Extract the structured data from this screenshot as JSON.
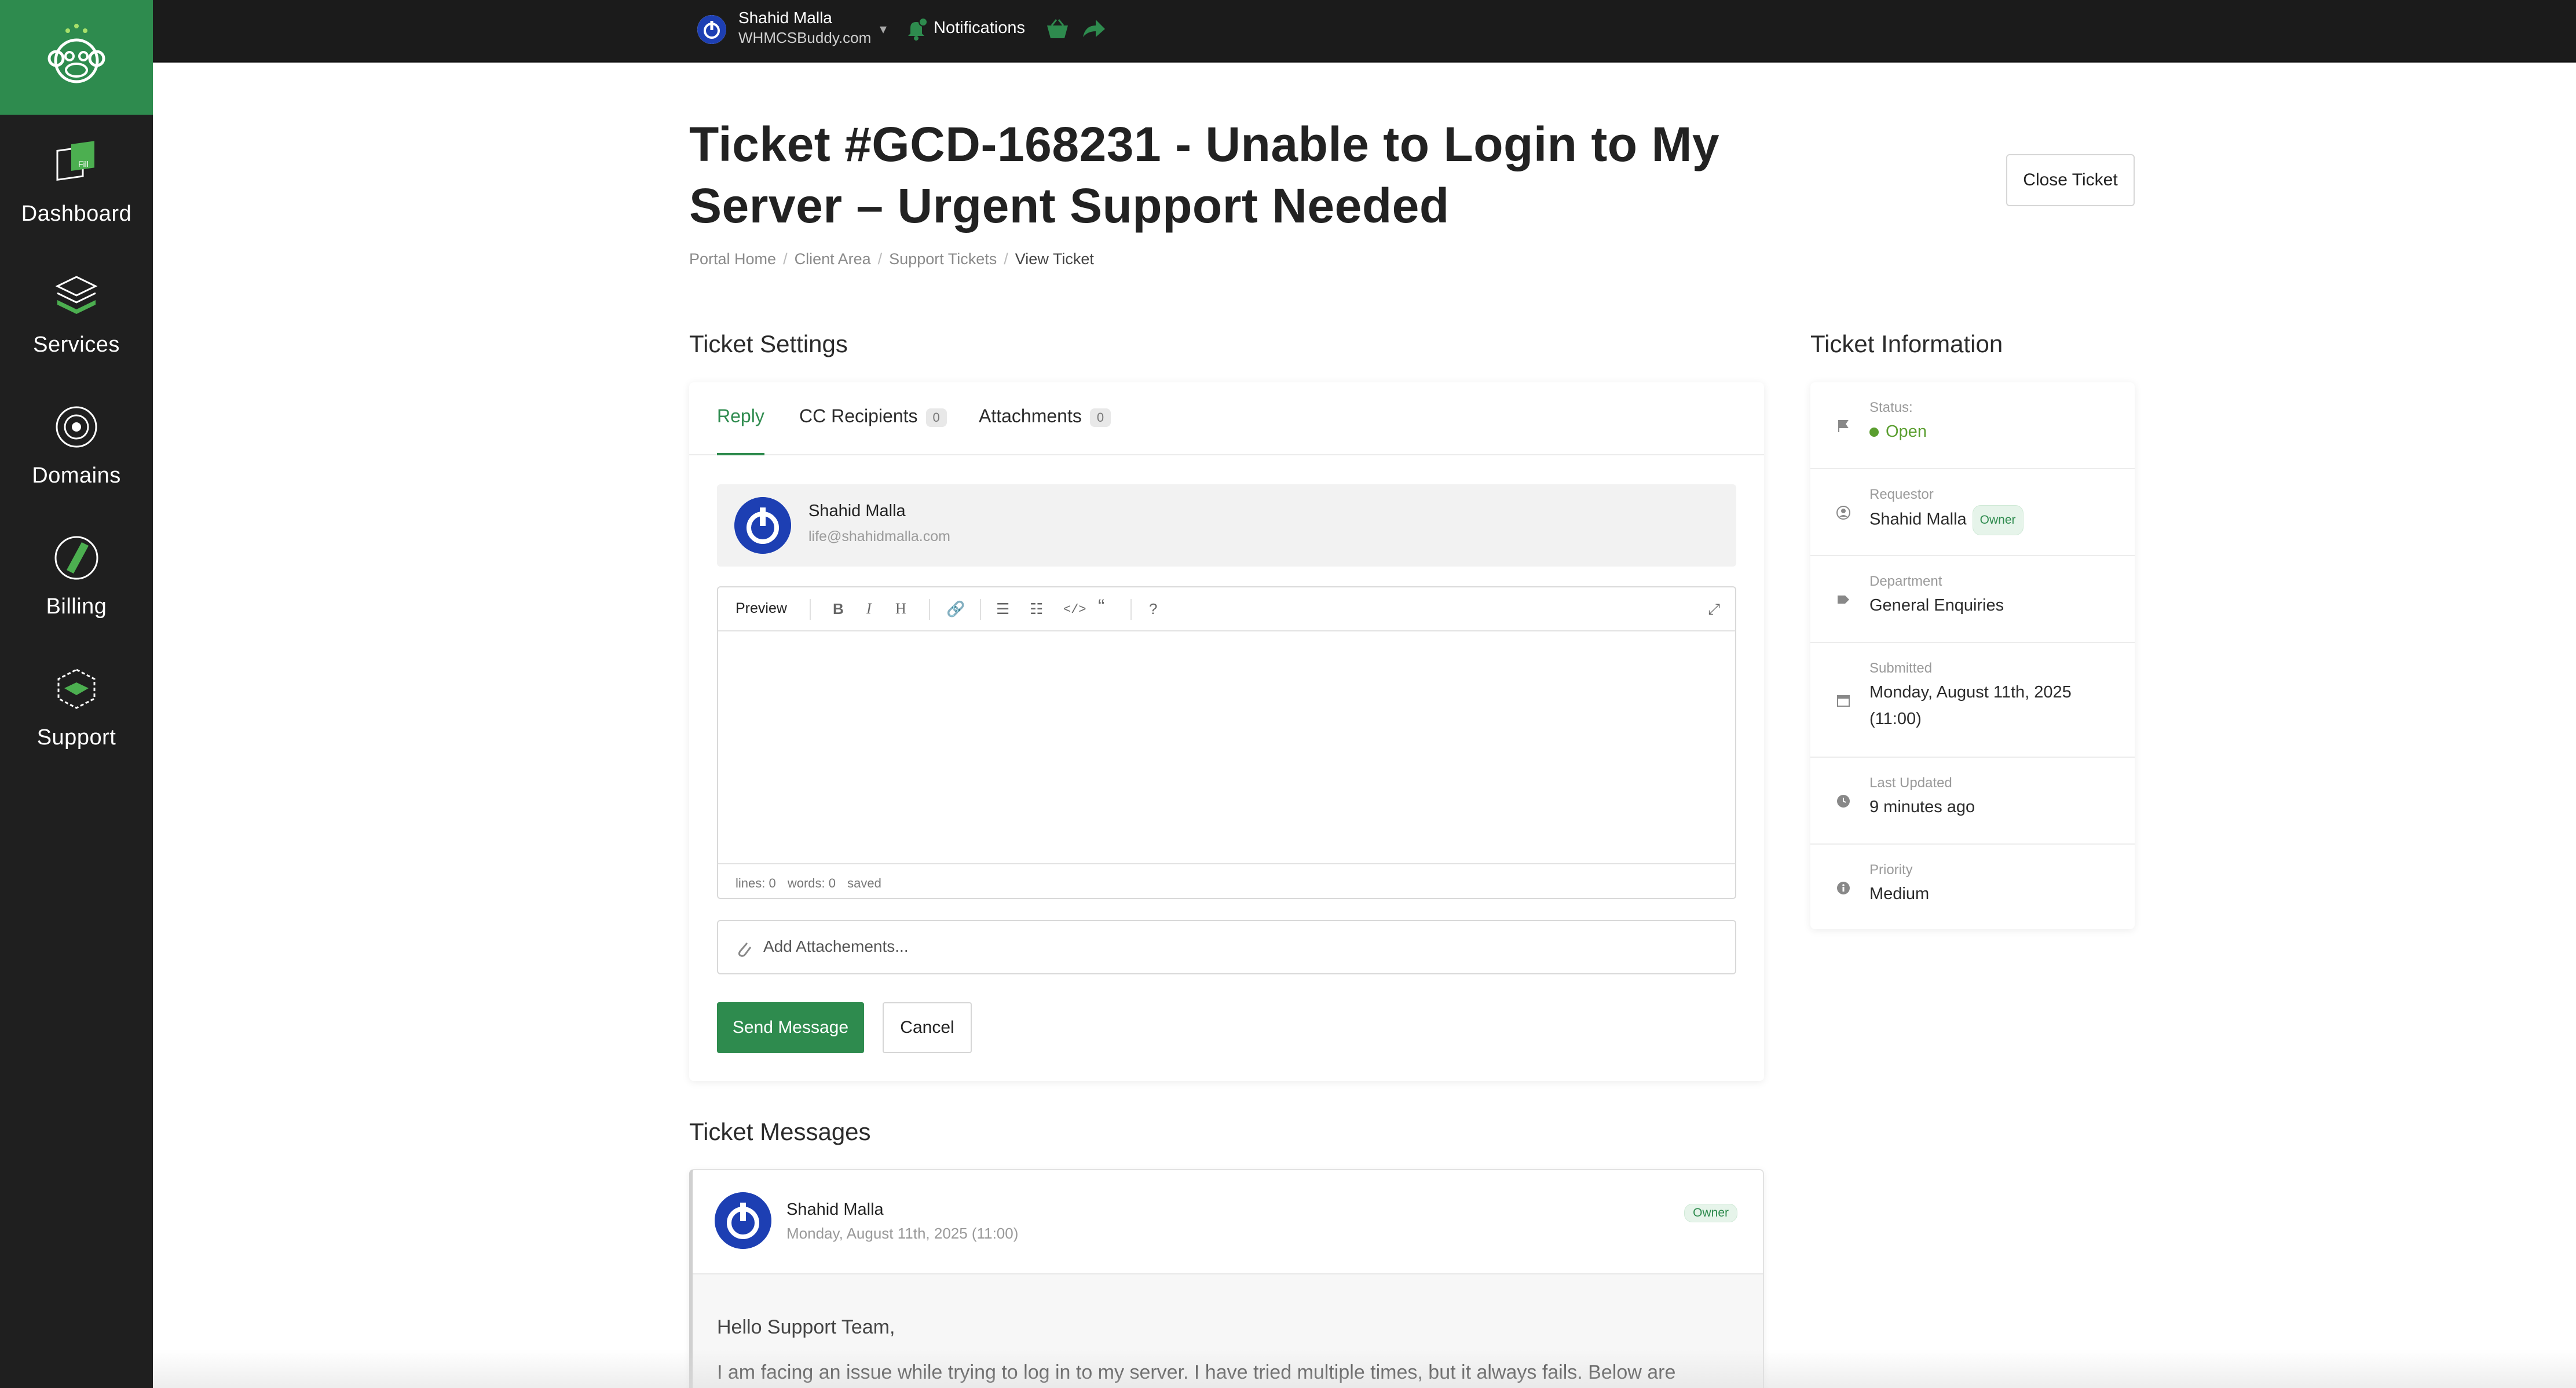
{
  "sidebar": {
    "items": [
      {
        "label": "Dashboard",
        "icon": "dashboard-icon"
      },
      {
        "label": "Services",
        "icon": "services-icon"
      },
      {
        "label": "Domains",
        "icon": "domains-icon"
      },
      {
        "label": "Billing",
        "icon": "billing-icon"
      },
      {
        "label": "Support",
        "icon": "support-icon"
      }
    ]
  },
  "topbar": {
    "user_name": "Shahid Malla",
    "user_company": "WHMCSBuddy.com",
    "notifications_label": "Notifications"
  },
  "page": {
    "title": "Ticket #GCD-168231 - Unable to Login to My Server – Urgent Support Needed",
    "close_button": "Close Ticket",
    "breadcrumb": [
      "Portal Home",
      "Client Area",
      "Support Tickets",
      "View Ticket"
    ]
  },
  "settings": {
    "heading": "Ticket Settings",
    "tabs": [
      {
        "label": "Reply"
      },
      {
        "label": "CC Recipients",
        "count": "0"
      },
      {
        "label": "Attachments",
        "count": "0"
      }
    ],
    "from_name": "Shahid Malla",
    "from_email": "life@shahidmalla.com",
    "editor": {
      "preview_label": "Preview",
      "lines": "lines: 0",
      "words": "words: 0",
      "saved": "saved"
    },
    "attach_label": "Add Attachements...",
    "send_button": "Send Message",
    "cancel_button": "Cancel"
  },
  "info": {
    "heading": "Ticket Information",
    "status_label": "Status:",
    "status_value": "Open",
    "requestor_label": "Requestor",
    "requestor_value": "Shahid Malla",
    "requestor_badge": "Owner",
    "department_label": "Department",
    "department_value": "General Enquiries",
    "submitted_label": "Submitted",
    "submitted_value_1": "Monday, August 11th, 2025",
    "submitted_value_2": "(11:00)",
    "updated_label": "Last Updated",
    "updated_value": "9 minutes ago",
    "priority_label": "Priority",
    "priority_value": "Medium"
  },
  "messages": {
    "heading": "Ticket Messages",
    "items": [
      {
        "author": "Shahid Malla",
        "date": "Monday, August 11th, 2025 (11:00)",
        "badge": "Owner",
        "greeting": "Hello Support Team,",
        "line1": "I am facing an issue while trying to log in to my server. I have tried multiple times, but it always fails. Below are"
      }
    ]
  },
  "colors": {
    "brand": "#2e8b4e",
    "sidebar": "#1f1f1f",
    "topbar": "#1b1b1b",
    "avatar": "#1d3fb3"
  }
}
